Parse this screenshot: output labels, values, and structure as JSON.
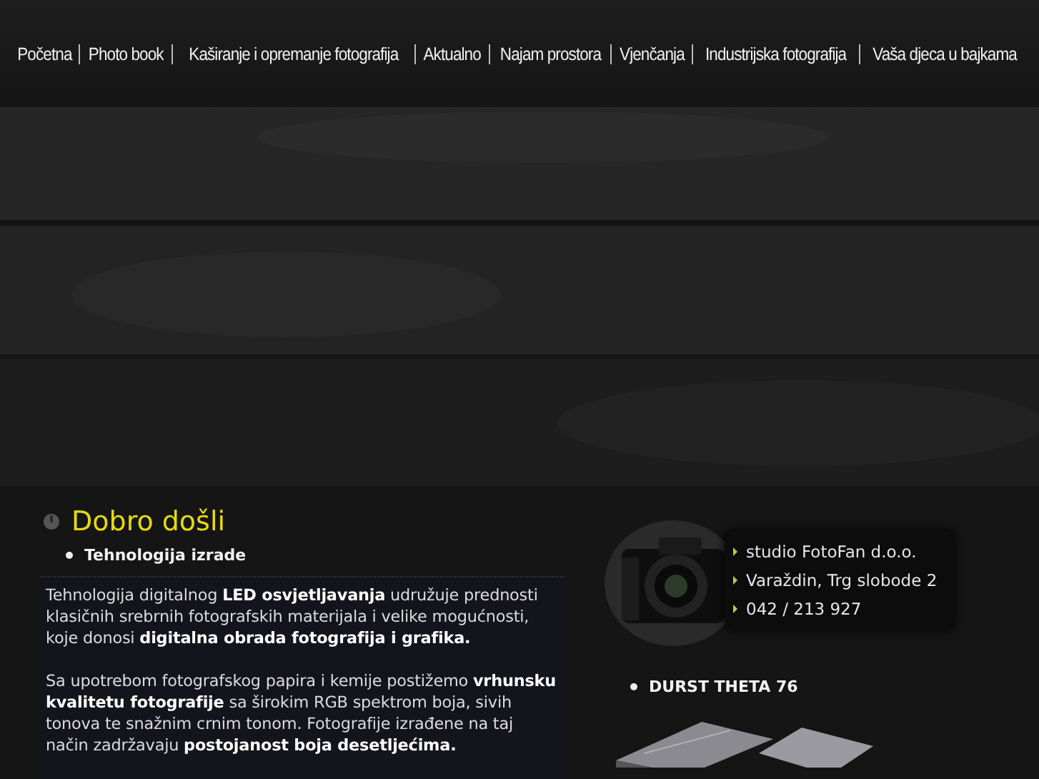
{
  "nav": {
    "items": [
      {
        "label": "Početna",
        "selected": false
      },
      {
        "label": "Photo book",
        "selected": false
      },
      {
        "label": "Kaširanje i opremanje fotografija",
        "selected": false
      },
      {
        "label": "Aktualno",
        "selected": false
      },
      {
        "label": "Najam prostora",
        "selected": false
      },
      {
        "label": "Vjenčanja",
        "selected": false
      },
      {
        "label": "Industrijska fotografija",
        "selected": false
      },
      {
        "label": "Vaša djeca u bajkama",
        "selected": false
      }
    ]
  },
  "welcome": {
    "title": "Dobro došli",
    "list": [
      "Tehnologija izrade"
    ],
    "paragraphs": [
      "Tehnologija digitalnog **LED osvjetljavanja** udružuje prednosti klasičnih srebrnih fotografskih materijala i velike mogućnosti, koje donosi **digitalna obrada fotografija i grafika.**",
      "Sa upotrebom fotografskog papira i kemije postižemo **vrhunsku kvalitetu fotografije** sa širokim RGB spektrom boja, sivih tonova te snažnim crnim tonom. Fotografije izrađene na taj način zadržavaju **postojanost boja desetljećima.**"
    ]
  },
  "contact": {
    "lines": [
      "studio FotoFan d.o.o.",
      "Varaždin, Trg slobode 2",
      "042 / 213 927"
    ]
  },
  "equipment": {
    "list": [
      "DURST THETA 76"
    ]
  }
}
